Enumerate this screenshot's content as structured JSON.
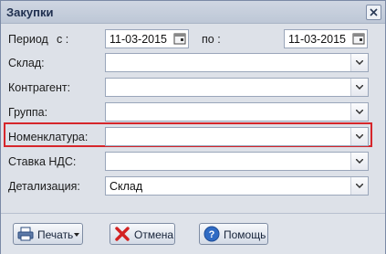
{
  "window": {
    "title": "Закупки"
  },
  "form": {
    "period_label": "Период",
    "from_label": "с :",
    "from_value": "11-03-2015",
    "to_label": "по :",
    "to_value": "11-03-2015",
    "fields": [
      {
        "label": "Склад:",
        "value": ""
      },
      {
        "label": "Контрагент:",
        "value": ""
      },
      {
        "label": "Группа:",
        "value": ""
      },
      {
        "label": "Номенклатура:",
        "value": ""
      },
      {
        "label": "Ставка НДС:",
        "value": ""
      },
      {
        "label": "Детализация:",
        "value": "Склад"
      }
    ]
  },
  "buttons": {
    "print": "Печать",
    "cancel": "Отмена",
    "help": "Помощь"
  },
  "colors": {
    "highlight": "#d6262b",
    "accent": "#1f2f4f"
  }
}
